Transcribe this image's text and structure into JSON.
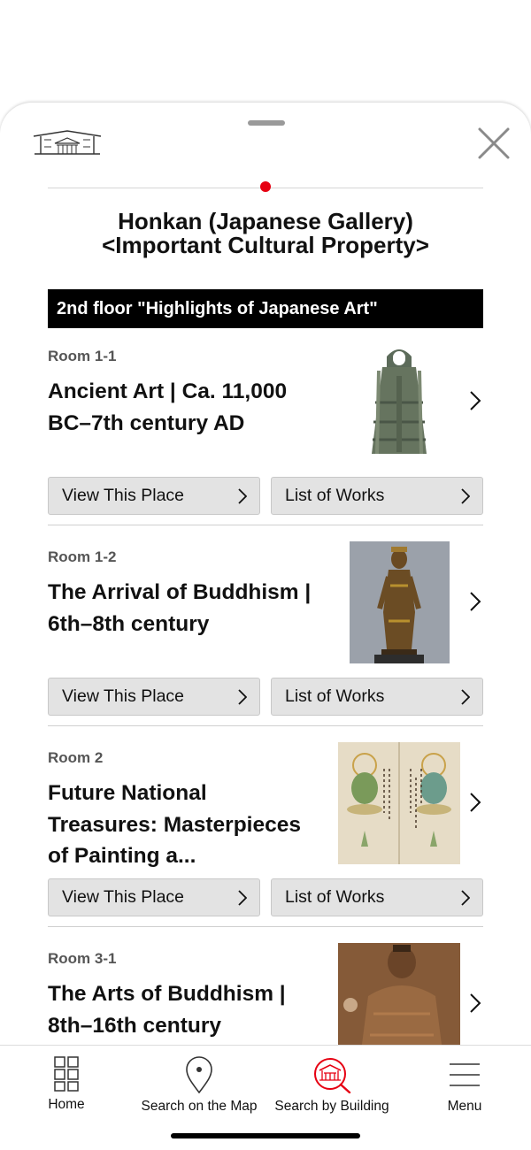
{
  "sheet": {
    "page_title_line1": "Honkan (Japanese Gallery)",
    "page_title_line2": "<Important Cultural Property>",
    "floor_heading": "2nd floor \"Highlights of Japanese Art\"",
    "logo_icon": "building-logo-icon",
    "close_icon": "close-icon",
    "accent_color": "#e60012"
  },
  "rooms": [
    {
      "label": "Room 1-1",
      "title_line1": "Ancient Art | Ca. 11,000",
      "title_line2": "BC–7th century AD",
      "title_line3": "",
      "image_subject": "bronze-bell-image",
      "view_label": "View This Place",
      "works_label": "List of Works"
    },
    {
      "label": "Room 1-2",
      "title_line1": "The Arrival of Buddhism |",
      "title_line2": "6th–8th century",
      "title_line3": "",
      "image_subject": "bodhisattva-statue-image",
      "view_label": "View This Place",
      "works_label": "List of Works"
    },
    {
      "label": "Room 2",
      "title_line1": "Future National",
      "title_line2": "Treasures: Masterpieces",
      "title_line3": "of Painting a...",
      "image_subject": "scroll-painting-image",
      "view_label": "View This Place",
      "works_label": "List of Works"
    },
    {
      "label": "Room 3-1",
      "title_line1": "The Arts of Buddhism |",
      "title_line2": "8th–16th century",
      "title_line3": "",
      "image_subject": "buddhist-painting-image",
      "view_label": "View This Place",
      "works_label": "List of Works"
    }
  ],
  "tabbar": {
    "tabs": [
      {
        "label": "Home",
        "icon": "grid-icon",
        "active": false
      },
      {
        "label": "Search on the Map",
        "icon": "map-pin-icon",
        "active": false
      },
      {
        "label": "Search by Building",
        "icon": "building-search-icon",
        "active": true
      },
      {
        "label": "Menu",
        "icon": "hamburger-icon",
        "active": false
      }
    ],
    "active_color": "#e60012"
  }
}
